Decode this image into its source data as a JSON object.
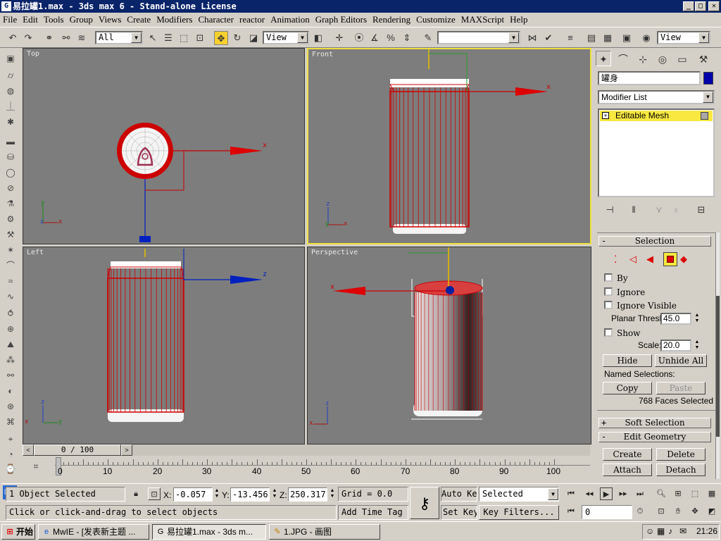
{
  "window": {
    "title": "易拉罐1.max - 3ds max 6 - Stand-alone License",
    "icon": "3ds-max-app-icon",
    "controls": [
      "_",
      "□",
      "✕"
    ]
  },
  "menu": [
    "File",
    "Edit",
    "Tools",
    "Group",
    "Views",
    "Create",
    "Modifiers",
    "Character",
    "reactor",
    "Animation",
    "Graph Editors",
    "Rendering",
    "Customize",
    "MAXScript",
    "Help"
  ],
  "toolbar": {
    "selection_filter": "All",
    "coord_system": "View",
    "named_selection": "",
    "view_right": "View"
  },
  "viewports": {
    "top": "Top",
    "front": "Front",
    "left": "Left",
    "perspective": "Perspective"
  },
  "axes": {
    "x": "x",
    "y": "y",
    "z": "z"
  },
  "panel": {
    "object_name": "罐身",
    "object_color": "#0000aa",
    "modifier_list": "Modifier List",
    "stack_item": "Editable Mesh",
    "selection": {
      "title": "Selection",
      "by_vertex": "By",
      "ignore_backfacing": "Ignore",
      "ignore_visible": "Ignore Visible",
      "planar_thresh_label": "Planar Thresh:",
      "planar_thresh_value": "45.0",
      "show_normals": "Show",
      "scale_label": "Scale:",
      "scale_value": "20.0",
      "hide": "Hide",
      "unhide_all": "Unhide All",
      "named_selections": "Named Selections:",
      "copy": "Copy",
      "paste": "Paste",
      "status": "768 Faces Selected"
    },
    "soft_selection": "Soft Selection",
    "edit_geometry": {
      "title": "Edit Geometry",
      "create": "Create",
      "delete": "Delete",
      "attach": "Attach",
      "detach": "Detach"
    }
  },
  "timeline": {
    "frame_display": "0 / 100",
    "ticks": [
      "0",
      "10",
      "20",
      "30",
      "40",
      "50",
      "60",
      "70",
      "80",
      "90",
      "100"
    ]
  },
  "status": {
    "selection_count": "1 Object Selected",
    "prompt": "Click or click-and-drag to select objects",
    "x_label": "X:",
    "x_value": "-0.057",
    "y_label": "Y:",
    "y_value": "-13.456",
    "z_label": "Z:",
    "z_value": "250.317",
    "grid": "Grid = 0.0",
    "add_time_tag": "Add Time Tag",
    "auto_key": "Auto Key",
    "set_key": "Set Key",
    "key_mode": "Selected",
    "key_filters": "Key Filters...",
    "current_frame": "0"
  },
  "taskbar": {
    "start": "开始",
    "tasks": [
      "MwIE - [发表新主题 ...",
      "易拉罐1.max - 3ds m...",
      "1.JPG - 画图"
    ],
    "clock": "21:26"
  }
}
